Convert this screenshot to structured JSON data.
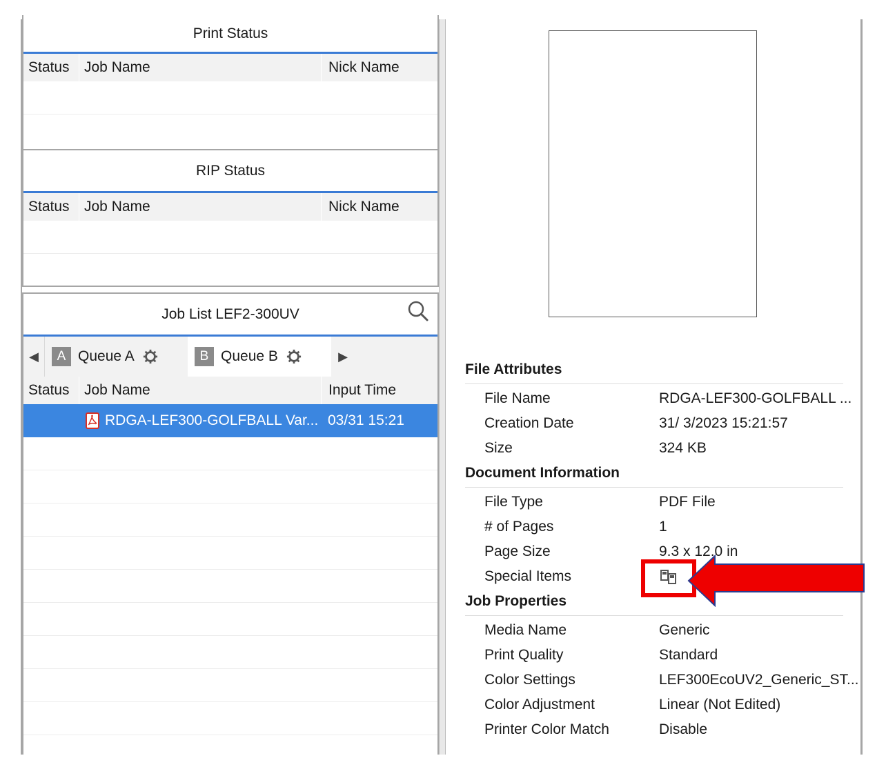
{
  "print_status": {
    "title": "Print Status",
    "columns": [
      "Status",
      "Job Name",
      "Nick Name"
    ]
  },
  "rip_status": {
    "title": "RIP Status",
    "columns": [
      "Status",
      "Job Name",
      "Nick Name"
    ]
  },
  "job_list": {
    "title": "Job List LEF2-300UV",
    "tabs": [
      {
        "letter": "A",
        "label": "Queue A"
      },
      {
        "letter": "B",
        "label": "Queue B"
      }
    ],
    "columns": [
      "Status",
      "Job Name",
      "Input Time"
    ],
    "rows": [
      {
        "job_name": "RDGA-LEF300-GOLFBALL Var...",
        "input_time": "03/31 15:21",
        "file_icon": "pdf-icon"
      }
    ]
  },
  "details": {
    "file_attributes": {
      "title": "File Attributes",
      "items": [
        {
          "label": "File Name",
          "value": "RDGA-LEF300-GOLFBALL ..."
        },
        {
          "label": "Creation Date",
          "value": "31/ 3/2023 15:21:57"
        },
        {
          "label": "Size",
          "value": "324 KB"
        }
      ]
    },
    "document_information": {
      "title": "Document Information",
      "items": [
        {
          "label": "File Type",
          "value": "PDF File"
        },
        {
          "label": "# of Pages",
          "value": "1"
        },
        {
          "label": "Page Size",
          "value": "9.3 x 12.0 in"
        },
        {
          "label": "Special Items",
          "value": ""
        }
      ]
    },
    "job_properties": {
      "title": "Job Properties",
      "items": [
        {
          "label": "Media Name",
          "value": "Generic"
        },
        {
          "label": "Print Quality",
          "value": "Standard"
        },
        {
          "label": "Color Settings",
          "value": "LEF300EcoUV2_Generic_ST..."
        },
        {
          "label": "Color Adjustment",
          "value": "Linear (Not Edited)"
        },
        {
          "label": "Printer Color Match",
          "value": "Disable"
        }
      ]
    }
  },
  "colors": {
    "accent": "#3a7bd5",
    "selection": "#3b86e0",
    "annotation_red": "#ee0000",
    "annotation_outline": "#2b3a8f"
  }
}
